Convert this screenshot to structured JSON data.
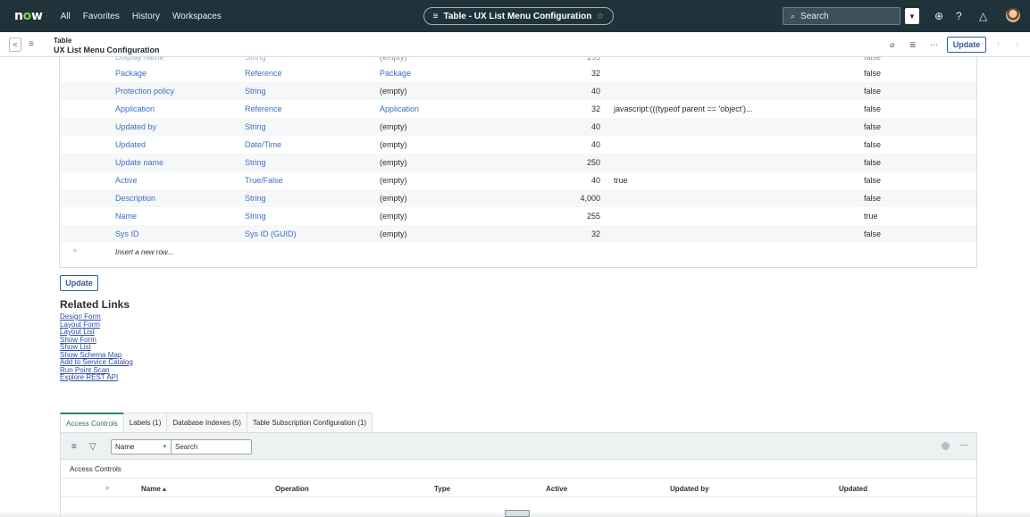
{
  "topnav": {
    "logo_prefix": "n",
    "logo_o": "o",
    "logo_suffix": "w",
    "menu": [
      "All",
      "Favorites",
      "History",
      "Workspaces"
    ],
    "center_title": "Table - UX List Menu Configuration",
    "search_placeholder": "Search"
  },
  "subheader": {
    "line1": "Table",
    "line2": "UX List Menu Configuration",
    "update_label": "Update"
  },
  "fields": {
    "rows": [
      {
        "column": "Package",
        "type": "Reference",
        "reference": "Package",
        "reference_is_link": true,
        "length": "32",
        "default": "",
        "display": "false"
      },
      {
        "column": "Protection policy",
        "type": "String",
        "reference": "(empty)",
        "reference_is_link": false,
        "length": "40",
        "default": "",
        "display": "false"
      },
      {
        "column": "Application",
        "type": "Reference",
        "reference": "Application",
        "reference_is_link": true,
        "length": "32",
        "default": "javascript:(((typeof parent == 'object')...",
        "display": "false"
      },
      {
        "column": "Updated by",
        "type": "String",
        "reference": "(empty)",
        "reference_is_link": false,
        "length": "40",
        "default": "",
        "display": "false"
      },
      {
        "column": "Updated",
        "type": "Date/Time",
        "reference": "(empty)",
        "reference_is_link": false,
        "length": "40",
        "default": "",
        "display": "false"
      },
      {
        "column": "Update name",
        "type": "String",
        "reference": "(empty)",
        "reference_is_link": false,
        "length": "250",
        "default": "",
        "display": "false"
      },
      {
        "column": "Active",
        "type": "True/False",
        "reference": "(empty)",
        "reference_is_link": false,
        "length": "40",
        "default": "true",
        "display": "false"
      },
      {
        "column": "Description",
        "type": "String",
        "reference": "(empty)",
        "reference_is_link": false,
        "length": "4,000",
        "default": "",
        "display": "false"
      },
      {
        "column": "Name",
        "type": "String",
        "reference": "(empty)",
        "reference_is_link": false,
        "length": "255",
        "default": "",
        "display": "true"
      },
      {
        "column": "Sys ID",
        "type": "Sys ID (GUID)",
        "reference": "(empty)",
        "reference_is_link": false,
        "length": "32",
        "default": "",
        "display": "false"
      }
    ],
    "insert_row_label": "Insert a new row..."
  },
  "update_button_label": "Update",
  "related_links": {
    "title": "Related Links",
    "links": [
      "Design Form",
      "Layout Form",
      "Layout List",
      "Show Form",
      "Show List",
      "Show Schema Map",
      "Add to Service Catalog",
      "Run Point Scan",
      "Explore REST API"
    ]
  },
  "tabs": [
    {
      "label": "Access Controls",
      "active": true
    },
    {
      "label": "Labels (1)",
      "active": false
    },
    {
      "label": "Database Indexes (5)",
      "active": false
    },
    {
      "label": "Table Subscription Configuration (1)",
      "active": false
    }
  ],
  "related_list": {
    "filter_field": "Name",
    "search_placeholder": "Search",
    "caption": "Access Controls",
    "columns": [
      "Name ▴",
      "Operation",
      "Type",
      "Active",
      "Updated by",
      "Updated"
    ]
  }
}
